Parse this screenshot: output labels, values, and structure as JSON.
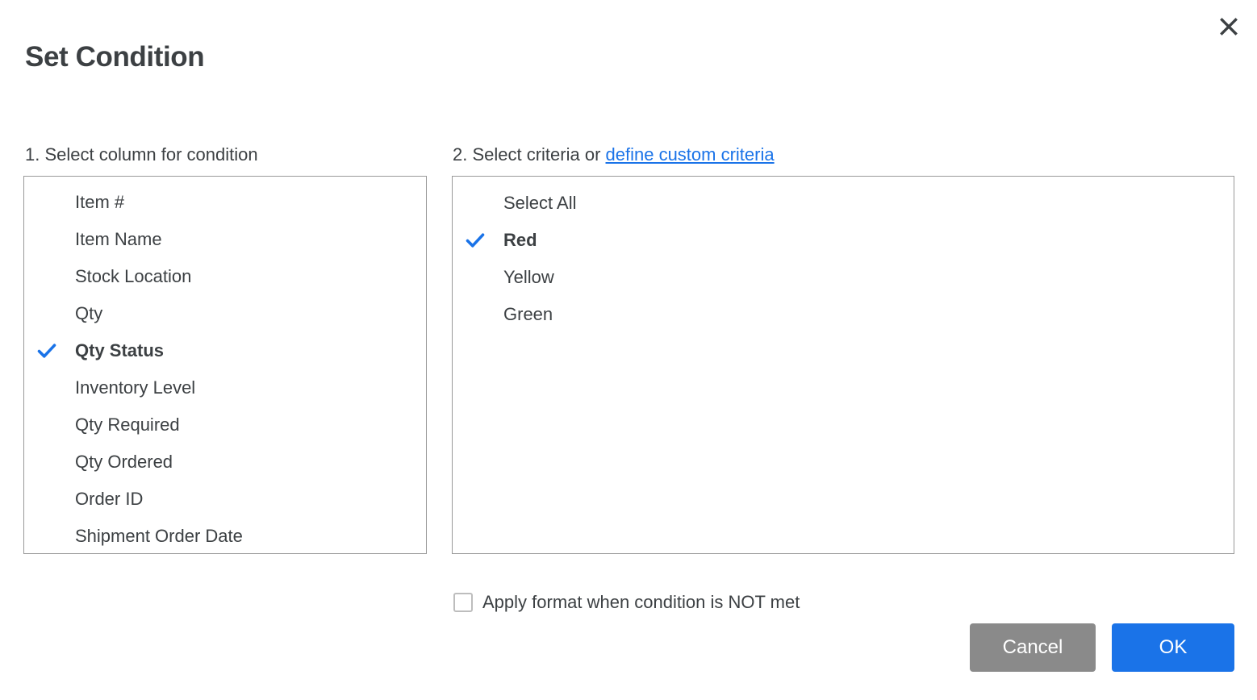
{
  "dialog": {
    "title": "Set Condition",
    "close_icon": "close-icon"
  },
  "column_section": {
    "heading": "1. Select column for condition",
    "items": [
      {
        "label": "Item #",
        "selected": false
      },
      {
        "label": "Item Name",
        "selected": false
      },
      {
        "label": "Stock Location",
        "selected": false
      },
      {
        "label": "Qty",
        "selected": false
      },
      {
        "label": "Qty Status",
        "selected": true
      },
      {
        "label": "Inventory Level",
        "selected": false
      },
      {
        "label": "Qty Required",
        "selected": false
      },
      {
        "label": "Qty Ordered",
        "selected": false
      },
      {
        "label": "Order ID",
        "selected": false
      },
      {
        "label": "Shipment Order Date",
        "selected": false
      }
    ]
  },
  "criteria_section": {
    "heading_prefix": "2. Select criteria or ",
    "heading_link": "define custom criteria",
    "items": [
      {
        "label": "Select All",
        "selected": false
      },
      {
        "label": "Red",
        "selected": true
      },
      {
        "label": "Yellow",
        "selected": false
      },
      {
        "label": "Green",
        "selected": false
      }
    ]
  },
  "options": {
    "not_met_label": "Apply format when condition is NOT met",
    "not_met_checked": false
  },
  "footer": {
    "cancel_label": "Cancel",
    "ok_label": "OK"
  },
  "colors": {
    "accent": "#1a73e8",
    "check": "#1a73e8",
    "cancel_bg": "#8a8a8a",
    "text": "#3c4043",
    "border": "#999999"
  }
}
